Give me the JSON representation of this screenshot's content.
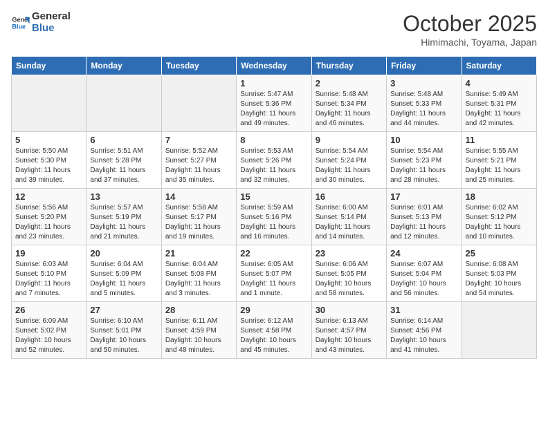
{
  "logo": {
    "line1": "General",
    "line2": "Blue"
  },
  "title": "October 2025",
  "subtitle": "Himimachi, Toyama, Japan",
  "weekdays": [
    "Sunday",
    "Monday",
    "Tuesday",
    "Wednesday",
    "Thursday",
    "Friday",
    "Saturday"
  ],
  "weeks": [
    [
      {
        "day": "",
        "info": ""
      },
      {
        "day": "",
        "info": ""
      },
      {
        "day": "",
        "info": ""
      },
      {
        "day": "1",
        "info": "Sunrise: 5:47 AM\nSunset: 5:36 PM\nDaylight: 11 hours\nand 49 minutes."
      },
      {
        "day": "2",
        "info": "Sunrise: 5:48 AM\nSunset: 5:34 PM\nDaylight: 11 hours\nand 46 minutes."
      },
      {
        "day": "3",
        "info": "Sunrise: 5:48 AM\nSunset: 5:33 PM\nDaylight: 11 hours\nand 44 minutes."
      },
      {
        "day": "4",
        "info": "Sunrise: 5:49 AM\nSunset: 5:31 PM\nDaylight: 11 hours\nand 42 minutes."
      }
    ],
    [
      {
        "day": "5",
        "info": "Sunrise: 5:50 AM\nSunset: 5:30 PM\nDaylight: 11 hours\nand 39 minutes."
      },
      {
        "day": "6",
        "info": "Sunrise: 5:51 AM\nSunset: 5:28 PM\nDaylight: 11 hours\nand 37 minutes."
      },
      {
        "day": "7",
        "info": "Sunrise: 5:52 AM\nSunset: 5:27 PM\nDaylight: 11 hours\nand 35 minutes."
      },
      {
        "day": "8",
        "info": "Sunrise: 5:53 AM\nSunset: 5:26 PM\nDaylight: 11 hours\nand 32 minutes."
      },
      {
        "day": "9",
        "info": "Sunrise: 5:54 AM\nSunset: 5:24 PM\nDaylight: 11 hours\nand 30 minutes."
      },
      {
        "day": "10",
        "info": "Sunrise: 5:54 AM\nSunset: 5:23 PM\nDaylight: 11 hours\nand 28 minutes."
      },
      {
        "day": "11",
        "info": "Sunrise: 5:55 AM\nSunset: 5:21 PM\nDaylight: 11 hours\nand 25 minutes."
      }
    ],
    [
      {
        "day": "12",
        "info": "Sunrise: 5:56 AM\nSunset: 5:20 PM\nDaylight: 11 hours\nand 23 minutes."
      },
      {
        "day": "13",
        "info": "Sunrise: 5:57 AM\nSunset: 5:19 PM\nDaylight: 11 hours\nand 21 minutes."
      },
      {
        "day": "14",
        "info": "Sunrise: 5:58 AM\nSunset: 5:17 PM\nDaylight: 11 hours\nand 19 minutes."
      },
      {
        "day": "15",
        "info": "Sunrise: 5:59 AM\nSunset: 5:16 PM\nDaylight: 11 hours\nand 16 minutes."
      },
      {
        "day": "16",
        "info": "Sunrise: 6:00 AM\nSunset: 5:14 PM\nDaylight: 11 hours\nand 14 minutes."
      },
      {
        "day": "17",
        "info": "Sunrise: 6:01 AM\nSunset: 5:13 PM\nDaylight: 11 hours\nand 12 minutes."
      },
      {
        "day": "18",
        "info": "Sunrise: 6:02 AM\nSunset: 5:12 PM\nDaylight: 11 hours\nand 10 minutes."
      }
    ],
    [
      {
        "day": "19",
        "info": "Sunrise: 6:03 AM\nSunset: 5:10 PM\nDaylight: 11 hours\nand 7 minutes."
      },
      {
        "day": "20",
        "info": "Sunrise: 6:04 AM\nSunset: 5:09 PM\nDaylight: 11 hours\nand 5 minutes."
      },
      {
        "day": "21",
        "info": "Sunrise: 6:04 AM\nSunset: 5:08 PM\nDaylight: 11 hours\nand 3 minutes."
      },
      {
        "day": "22",
        "info": "Sunrise: 6:05 AM\nSunset: 5:07 PM\nDaylight: 11 hours\nand 1 minute."
      },
      {
        "day": "23",
        "info": "Sunrise: 6:06 AM\nSunset: 5:05 PM\nDaylight: 10 hours\nand 58 minutes."
      },
      {
        "day": "24",
        "info": "Sunrise: 6:07 AM\nSunset: 5:04 PM\nDaylight: 10 hours\nand 56 minutes."
      },
      {
        "day": "25",
        "info": "Sunrise: 6:08 AM\nSunset: 5:03 PM\nDaylight: 10 hours\nand 54 minutes."
      }
    ],
    [
      {
        "day": "26",
        "info": "Sunrise: 6:09 AM\nSunset: 5:02 PM\nDaylight: 10 hours\nand 52 minutes."
      },
      {
        "day": "27",
        "info": "Sunrise: 6:10 AM\nSunset: 5:01 PM\nDaylight: 10 hours\nand 50 minutes."
      },
      {
        "day": "28",
        "info": "Sunrise: 6:11 AM\nSunset: 4:59 PM\nDaylight: 10 hours\nand 48 minutes."
      },
      {
        "day": "29",
        "info": "Sunrise: 6:12 AM\nSunset: 4:58 PM\nDaylight: 10 hours\nand 45 minutes."
      },
      {
        "day": "30",
        "info": "Sunrise: 6:13 AM\nSunset: 4:57 PM\nDaylight: 10 hours\nand 43 minutes."
      },
      {
        "day": "31",
        "info": "Sunrise: 6:14 AM\nSunset: 4:56 PM\nDaylight: 10 hours\nand 41 minutes."
      },
      {
        "day": "",
        "info": ""
      }
    ]
  ]
}
